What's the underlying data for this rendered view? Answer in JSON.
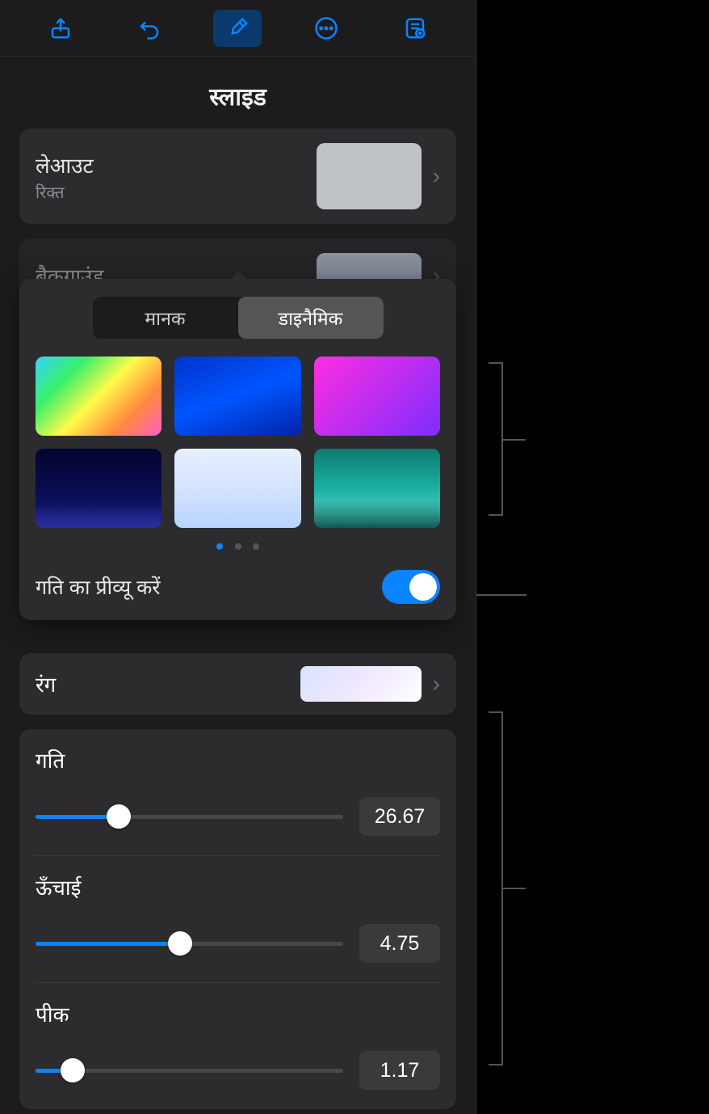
{
  "header": {
    "title": "स्लाइड"
  },
  "layout_row": {
    "label": "लेआउट",
    "sublabel": "रिक्त"
  },
  "background_row": {
    "label": "बैकग्राउंड"
  },
  "segmented": {
    "standard": "मानक",
    "dynamic": "डाइनैमिक"
  },
  "preview_motion_label": "गति का प्रीव्यू करें",
  "color_row_label": "रंग",
  "sliders": {
    "speed": {
      "label": "गति",
      "value": "26.67",
      "percent": 27
    },
    "height": {
      "label": "ऊँचाई",
      "value": "4.75",
      "percent": 47
    },
    "peak": {
      "label": "पीक",
      "value": "1.17",
      "percent": 12
    }
  },
  "icons": {
    "share": "share-icon",
    "undo": "undo-icon",
    "format": "brush-icon",
    "more": "more-icon",
    "presenter": "presenter-icon"
  }
}
